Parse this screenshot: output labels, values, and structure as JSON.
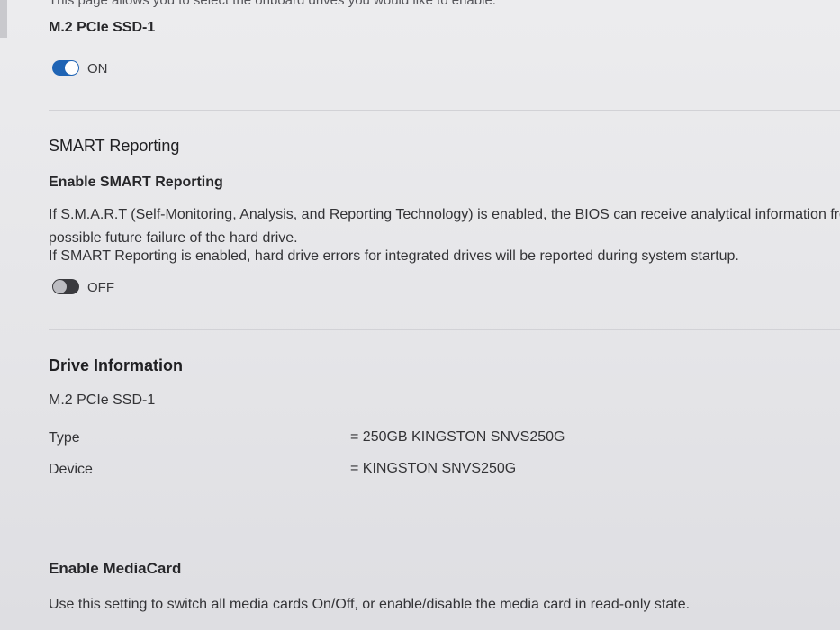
{
  "page": {
    "intro_text": "This page allows you to select the onboard drives you would like to enable.",
    "drive_option": {
      "label": "M.2 PCIe SSD-1",
      "toggle_state": "ON"
    }
  },
  "smart": {
    "section_title": "SMART Reporting",
    "setting_title": "Enable SMART Reporting",
    "description_line1": "If S.M.A.R.T (Self-Monitoring, Analysis, and Reporting Technology) is enabled, the BIOS can receive analytical information fro",
    "description_line2": "possible future failure of the hard drive.",
    "description_line3": "If SMART Reporting is enabled, hard drive errors for integrated drives will be reported during system startup.",
    "toggle_state": "OFF"
  },
  "drive_info": {
    "section_title": "Drive Information",
    "drive_name": "M.2 PCIe SSD-1",
    "rows": [
      {
        "label": "Type",
        "value": "= 250GB KINGSTON SNVS250G"
      },
      {
        "label": "Device",
        "value": "= KINGSTON SNVS250G"
      }
    ]
  },
  "mediacard": {
    "section_title": "Enable MediaCard",
    "description": "Use this setting to switch all media cards On/Off, or enable/disable the media card in read-only state."
  },
  "colors": {
    "toggle_on": "#1f64b5",
    "toggle_off": "#3a3a3e",
    "background": "#e6e6e8"
  }
}
